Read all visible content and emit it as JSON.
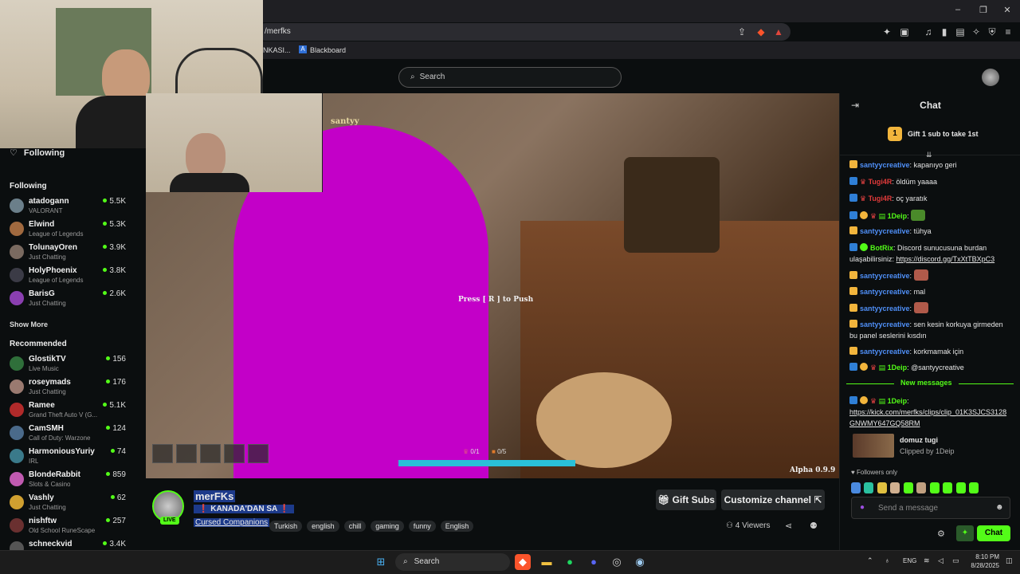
{
  "browser": {
    "url": "/merfks",
    "bookmarks": [
      "NKASI...",
      "Blackboard"
    ],
    "window_controls": [
      "–",
      "❐",
      "✕"
    ]
  },
  "header": {
    "search_placeholder": "Search"
  },
  "sidebar": {
    "following_title": "Following",
    "following_section": "Following",
    "following": [
      {
        "name": "atadogann",
        "category": "VALORANT",
        "viewers": "5.5K",
        "color": "#6b7f8a"
      },
      {
        "name": "Elwind",
        "category": "League of Legends",
        "viewers": "5.3K",
        "color": "#a0693f"
      },
      {
        "name": "TolunayOren",
        "category": "Just Chatting",
        "viewers": "3.9K",
        "color": "#7a6a60"
      },
      {
        "name": "HolyPhoenix",
        "category": "League of Legends",
        "viewers": "3.8K",
        "color": "#3b3b46"
      },
      {
        "name": "BarisG",
        "category": "Just Chatting",
        "viewers": "2.6K",
        "color": "#8a3fb0"
      }
    ],
    "show_more": "Show More",
    "recommended_section": "Recommended",
    "recommended": [
      {
        "name": "GlostikTV",
        "category": "Live Music",
        "viewers": "156",
        "color": "#2f6f3a"
      },
      {
        "name": "roseymads",
        "category": "Just Chatting",
        "viewers": "176",
        "color": "#9a7a70"
      },
      {
        "name": "Ramee",
        "category": "Grand Theft Auto V (G...",
        "viewers": "5.1K",
        "color": "#b02a2a"
      },
      {
        "name": "CamSMH",
        "category": "Call of Duty: Warzone",
        "viewers": "124",
        "color": "#4a6a8a"
      },
      {
        "name": "HarmoniousYuriy",
        "category": "IRL",
        "viewers": "74",
        "color": "#3a7a8a"
      },
      {
        "name": "BlondeRabbit",
        "category": "Slots & Casino",
        "viewers": "859",
        "color": "#c05ab0"
      },
      {
        "name": "Vashly",
        "category": "Just Chatting",
        "viewers": "62",
        "color": "#d0a030"
      },
      {
        "name": "nishftw",
        "category": "Old School RuneScape",
        "viewers": "257",
        "color": "#6a3030"
      },
      {
        "name": "schneckvid",
        "category": "",
        "viewers": "3.4K",
        "color": "#555555"
      }
    ]
  },
  "video": {
    "overlay_name": "santyy",
    "prompt": "Press [ R ] to Push",
    "version": "Alpha 0.9.9",
    "hud_counts": [
      "0/1",
      "0/5"
    ]
  },
  "stream": {
    "channel": "merFKs",
    "live_badge": "LIVE",
    "title": "❗ KANADA'DAN SA ❗",
    "category": "Cursed Companions",
    "tags": [
      "Turkish",
      "english",
      "chill",
      "gaming",
      "funny",
      "English"
    ],
    "gift_subs": "Gift Subs",
    "customize": "Customize channel",
    "viewers": "4 Viewers"
  },
  "chat": {
    "title": "Chat",
    "gift_banner": "Gift 1 sub to take 1st",
    "gift_rank": "1",
    "new_messages": "New messages",
    "messages": [
      {
        "user": "santyycreative",
        "cls": "u-sant",
        "text": "kapanıyo geri"
      },
      {
        "user": "Tugi4R",
        "cls": "u-tugi",
        "text": "öldüm yaaaa"
      },
      {
        "user": "Tugi4R",
        "cls": "u-tugi",
        "text": "oç yaratık"
      },
      {
        "user": "1Deip",
        "cls": "u-deip",
        "text": ""
      },
      {
        "user": "santyycreative",
        "cls": "u-sant",
        "text": "tühya"
      },
      {
        "user": "BotRix",
        "cls": "u-bot",
        "text": "Discord sunucusuna burdan ulaşabilirsiniz:",
        "link": "https://discord.gg/TxXtTBXpC3"
      },
      {
        "user": "santyycreative",
        "cls": "u-sant",
        "text": ""
      },
      {
        "user": "santyycreative",
        "cls": "u-sant",
        "text": "mal"
      },
      {
        "user": "santyycreative",
        "cls": "u-sant",
        "text": ""
      },
      {
        "user": "santyycreative",
        "cls": "u-sant",
        "text": "sen kesin korkuya girmeden bu panel seslerini kısdın"
      },
      {
        "user": "santyycreative",
        "cls": "u-sant",
        "text": "korkmamak için"
      },
      {
        "user": "1Deip",
        "cls": "u-deip",
        "text": "@santyycreative"
      }
    ],
    "new_msg": {
      "user": "1Deip",
      "link": "https://kick.com/merfks/clips/clip_01K3SJCS3128GNWMY647GQ58RM"
    },
    "clip": {
      "title": "domuz tugi",
      "by": "Clipped by 1Deip"
    },
    "followers_only": "Followers only",
    "input_placeholder": "Send a message",
    "send_label": "Chat"
  },
  "taskbar": {
    "search": "Search",
    "lang": "ENG",
    "time": "8:10 PM",
    "date": "8/28/2025"
  },
  "colors": {
    "accent": "#53fc18",
    "background": "#0b0e0f"
  }
}
